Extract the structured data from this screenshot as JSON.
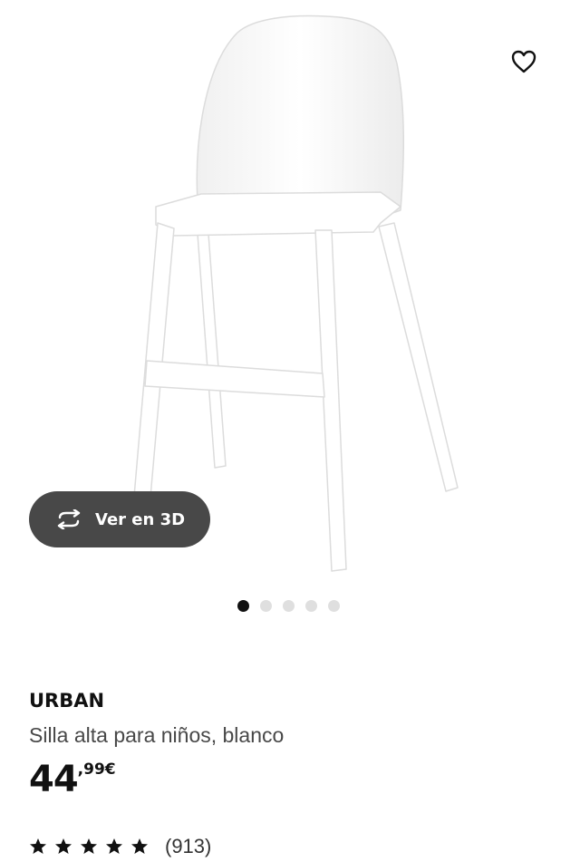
{
  "product": {
    "name": "URBAN",
    "description": "Silla alta para niños, blanco",
    "image_icon": "high-chair-image",
    "price": {
      "integer": "44",
      "decimal": ",99€"
    },
    "rating": {
      "stars": 5,
      "max_stars": 5,
      "review_count": "(913)"
    }
  },
  "actions": {
    "favorite_icon": "heart-outline-icon",
    "view_3d_label": "Ver en 3D",
    "view_3d_icon": "rotate-arrows-icon"
  },
  "carousel": {
    "total": 5,
    "active_index": 0
  },
  "colors": {
    "button_bg": "#484848",
    "text_primary": "#111111",
    "text_secondary": "#484848",
    "dot_active": "#111111",
    "dot_inactive": "#dfdfdf"
  }
}
